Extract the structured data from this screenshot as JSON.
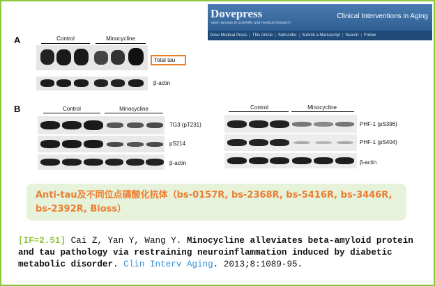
{
  "banner": {
    "brand": "Dovepress",
    "tagline": "open access to scientific and medical research",
    "journal": "Clinical Interventions in Aging",
    "nav": [
      "Dove Medical Press",
      "This Article",
      "Subscribe",
      "Submit a Manuscript",
      "Search",
      "Follow"
    ]
  },
  "panel_a": {
    "letter": "A",
    "groups": [
      "Control",
      "Minocycline"
    ],
    "rows": [
      "Total tau",
      "β-actin"
    ]
  },
  "panel_b": {
    "letter": "B",
    "left_groups": [
      "Control",
      "Minocycline"
    ],
    "left_rows": [
      "TG3 (pT231)",
      "pS214",
      "β-actin"
    ],
    "right_groups": [
      "Control",
      "Minocycline"
    ],
    "right_rows": [
      "PHF-1 (pS396)",
      "PHF-1 (pS404)",
      "β-actin"
    ]
  },
  "callout": {
    "text": "Anti-tau及不同位点磷酸化抗体（bs-0157R, bs-2368R, bs-5416R, bs-3446R, bs-2392R, Bioss）"
  },
  "citation": {
    "impact": "[IF=2.51]",
    "authors": " Cai Z, Yan Y, Wang Y. ",
    "title": "Minocycline alleviates beta-amyloid protein and tau pathology via restraining neuroinflammation induced by diabetic metabolic disorder",
    "sep": ". ",
    "journal": "Clin Interv Aging",
    "tail": ". 2013;8:1089-95."
  },
  "colors": {
    "border": "#8cc83c",
    "accent_orange": "#ec7d30",
    "callout_bg": "#e6f2d9",
    "journal_link": "#2f8fd8"
  }
}
